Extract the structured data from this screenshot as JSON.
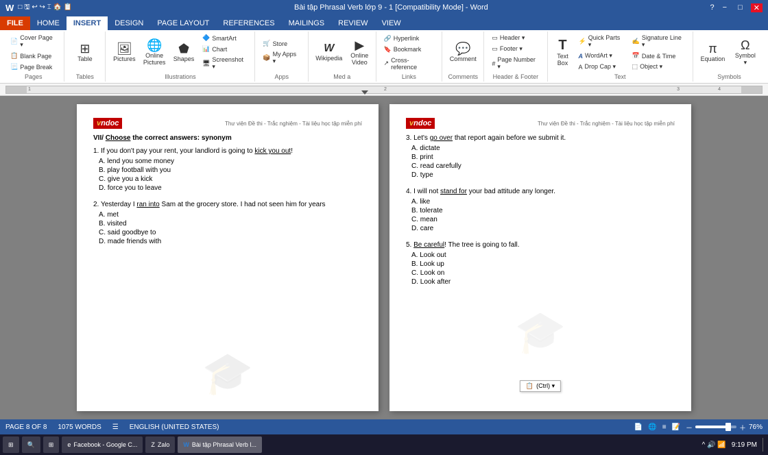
{
  "titlebar": {
    "title": "Bài tập Phrasal Verb lớp 9 - 1 [Compatibility Mode] - Word",
    "help_icon": "?",
    "minimize_label": "−",
    "restore_label": "□",
    "close_label": "✕"
  },
  "ribbon": {
    "tabs": [
      {
        "label": "FILE",
        "active": false
      },
      {
        "label": "HOME",
        "active": false
      },
      {
        "label": "INSERT",
        "active": true
      },
      {
        "label": "DESIGN",
        "active": false
      },
      {
        "label": "PAGE LAYOUT",
        "active": false
      },
      {
        "label": "REFERENCES",
        "active": false
      },
      {
        "label": "MAILINGS",
        "active": false
      },
      {
        "label": "REVIEW",
        "active": false
      },
      {
        "label": "VIEW",
        "active": false
      }
    ],
    "groups": [
      {
        "label": "Pages",
        "items": [
          {
            "label": "Cover Page ▾",
            "icon": "📄"
          },
          {
            "label": "Blank Page",
            "icon": "📋"
          },
          {
            "label": "Page Break",
            "icon": "📃"
          }
        ]
      },
      {
        "label": "Tables",
        "items": [
          {
            "label": "Table",
            "icon": "⊞"
          }
        ]
      },
      {
        "label": "Illustrations",
        "items": [
          {
            "label": "Pictures",
            "icon": "🖼"
          },
          {
            "label": "Online Pictures",
            "icon": "🌐"
          },
          {
            "label": "Shapes",
            "icon": "⬟"
          },
          {
            "label": "SmartArt",
            "icon": "🔷"
          },
          {
            "label": "Chart",
            "icon": "📊"
          },
          {
            "label": "Screenshot ▾",
            "icon": "🖥"
          }
        ]
      },
      {
        "label": "Apps",
        "items": [
          {
            "label": "Store",
            "icon": "🛒"
          },
          {
            "label": "My Apps ▾",
            "icon": "📦"
          }
        ]
      },
      {
        "label": "Media",
        "items": [
          {
            "label": "Wikipedia",
            "icon": "W"
          },
          {
            "label": "Online Video",
            "icon": "▶"
          }
        ]
      },
      {
        "label": "Links",
        "items": [
          {
            "label": "Hyperlink",
            "icon": "🔗"
          },
          {
            "label": "Bookmark",
            "icon": "🔖"
          },
          {
            "label": "Cross-reference",
            "icon": "↗"
          }
        ]
      },
      {
        "label": "Comments",
        "items": [
          {
            "label": "Comment",
            "icon": "💬"
          }
        ]
      },
      {
        "label": "Header & Footer",
        "items": [
          {
            "label": "Header ▾",
            "icon": "—"
          },
          {
            "label": "Footer ▾",
            "icon": "—"
          },
          {
            "label": "Page Number ▾",
            "icon": "#"
          }
        ]
      },
      {
        "label": "Text",
        "items": [
          {
            "label": "Text Box",
            "icon": "T"
          },
          {
            "label": "Quick Parts ▾",
            "icon": "⚡"
          },
          {
            "label": "WordArt ▾",
            "icon": "A"
          },
          {
            "label": "Drop Cap ▾",
            "icon": "A"
          },
          {
            "label": "Signature Line ▾",
            "icon": "✍"
          },
          {
            "label": "Date & Time",
            "icon": "📅"
          },
          {
            "label": "Object ▾",
            "icon": "⬚"
          }
        ]
      },
      {
        "label": "Symbols",
        "items": [
          {
            "label": "Equation",
            "icon": "π"
          },
          {
            "label": "Symbol ▾",
            "icon": "Ω"
          }
        ]
      }
    ]
  },
  "page1": {
    "logo_text": "vndoc",
    "header_text": "Thư viện Đề thi - Trắc nghiệm - Tài liệu học tập miễn phí",
    "section_title": "VII/ Choose the correct answers: synonym",
    "questions": [
      {
        "id": "1",
        "text": "If you don't pay your rent, your landlord is going to kick you out!",
        "underline": "kick you out",
        "answers": [
          {
            "letter": "A",
            "text": "lend you some money"
          },
          {
            "letter": "B",
            "text": "play football with you"
          },
          {
            "letter": "C",
            "text": "give you a kick"
          },
          {
            "letter": "D",
            "text": "force you to leave"
          }
        ]
      },
      {
        "id": "2",
        "text": "Yesterday I ran into Sam at the grocery store. I had not seen him for years",
        "underline": "ran into",
        "answers": [
          {
            "letter": "A",
            "text": "met"
          },
          {
            "letter": "B",
            "text": "visited"
          },
          {
            "letter": "C",
            "text": "said goodbye to"
          },
          {
            "letter": "D",
            "text": "made friends with"
          }
        ]
      }
    ]
  },
  "page2": {
    "logo_text": "vndoc",
    "header_text": "Thư viện Đề thi - Trắc nghiệm - Tài liệu học tập miễn phí",
    "questions": [
      {
        "id": "3",
        "text": "Let's go over that report again before we submit it.",
        "underline": "go over",
        "answers": [
          {
            "letter": "A",
            "text": "dictate"
          },
          {
            "letter": "B",
            "text": "print"
          },
          {
            "letter": "C",
            "text": "read carefully"
          },
          {
            "letter": "D",
            "text": "type"
          }
        ]
      },
      {
        "id": "4",
        "text": "I will not stand for your bad attitude any longer.",
        "underline": "stand for",
        "answers": [
          {
            "letter": "A",
            "text": "like"
          },
          {
            "letter": "B",
            "text": "tolerate"
          },
          {
            "letter": "C",
            "text": "mean"
          },
          {
            "letter": "D",
            "text": "care"
          }
        ]
      },
      {
        "id": "5",
        "text": "Be careful! The tree is going to fall.",
        "underline": "Be careful",
        "answers": [
          {
            "letter": "A",
            "text": "Look out"
          },
          {
            "letter": "B",
            "text": "Look up"
          },
          {
            "letter": "C",
            "text": "Look on"
          },
          {
            "letter": "D",
            "text": "Look after"
          }
        ]
      }
    ],
    "paste_popup": "(Ctrl) ▾"
  },
  "statusbar": {
    "page_info": "PAGE 8 OF 8",
    "word_count": "1075 WORDS",
    "language": "ENGLISH (UNITED STATES)",
    "zoom": "76%"
  },
  "taskbar": {
    "items": [
      {
        "label": "⊞",
        "type": "start"
      },
      {
        "label": "🔍",
        "type": "search"
      },
      {
        "label": "⊞",
        "type": "taskview"
      },
      {
        "label": "e  Facebook - Google C...",
        "type": "app"
      },
      {
        "label": "Zalo",
        "type": "app"
      },
      {
        "label": "W  Bài tập Phrasal Verb l...",
        "type": "app",
        "active": true
      }
    ],
    "time": "9:19 PM",
    "date": "",
    "tray_icons": "^ 🔊 📶 🔋"
  }
}
